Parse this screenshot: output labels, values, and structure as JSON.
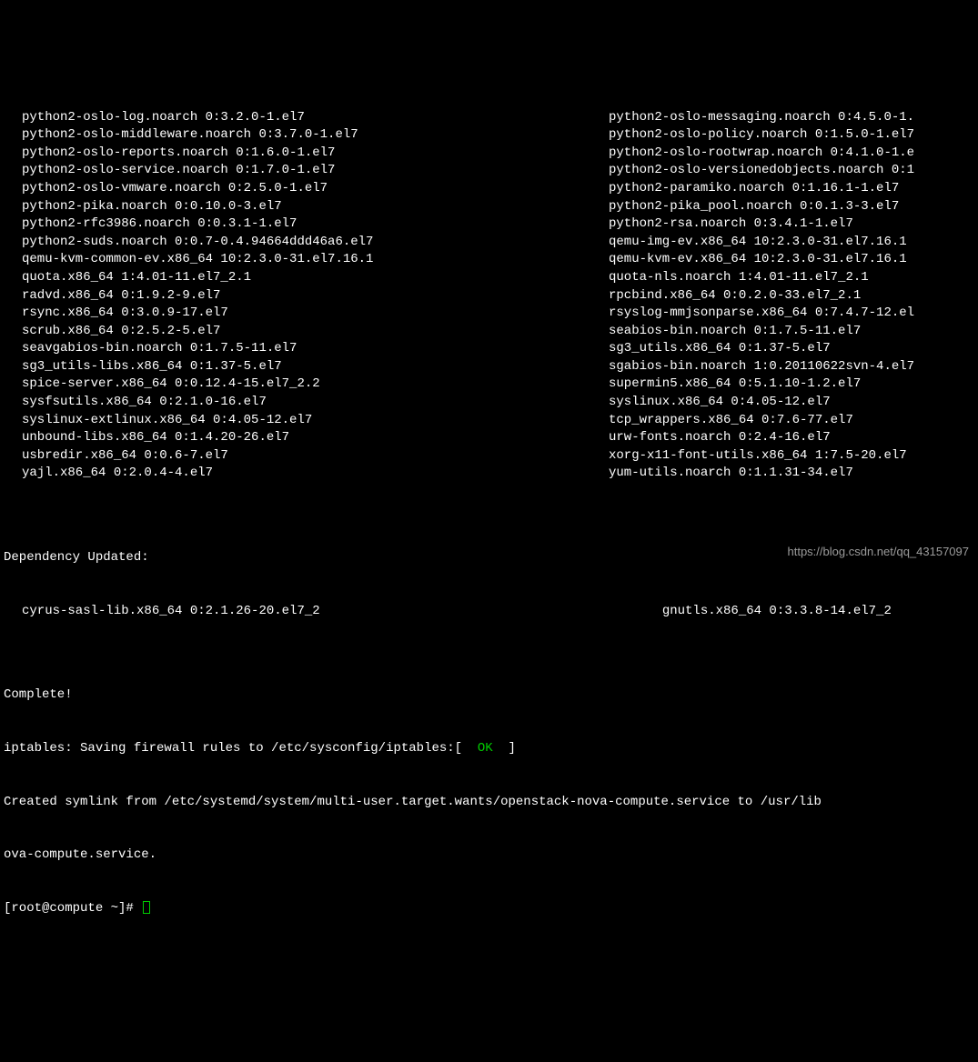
{
  "packages_left": [
    "python2-oslo-log.noarch 0:3.2.0-1.el7",
    "python2-oslo-middleware.noarch 0:3.7.0-1.el7",
    "python2-oslo-reports.noarch 0:1.6.0-1.el7",
    "python2-oslo-service.noarch 0:1.7.0-1.el7",
    "python2-oslo-vmware.noarch 0:2.5.0-1.el7",
    "python2-pika.noarch 0:0.10.0-3.el7",
    "python2-rfc3986.noarch 0:0.3.1-1.el7",
    "python2-suds.noarch 0:0.7-0.4.94664ddd46a6.el7",
    "qemu-kvm-common-ev.x86_64 10:2.3.0-31.el7.16.1",
    "quota.x86_64 1:4.01-11.el7_2.1",
    "radvd.x86_64 0:1.9.2-9.el7",
    "rsync.x86_64 0:3.0.9-17.el7",
    "scrub.x86_64 0:2.5.2-5.el7",
    "seavgabios-bin.noarch 0:1.7.5-11.el7",
    "sg3_utils-libs.x86_64 0:1.37-5.el7",
    "spice-server.x86_64 0:0.12.4-15.el7_2.2",
    "sysfsutils.x86_64 0:2.1.0-16.el7",
    "syslinux-extlinux.x86_64 0:4.05-12.el7",
    "unbound-libs.x86_64 0:1.4.20-26.el7",
    "usbredir.x86_64 0:0.6-7.el7",
    "yajl.x86_64 0:2.0.4-4.el7"
  ],
  "packages_right": [
    "python2-oslo-messaging.noarch 0:4.5.0-1.",
    "python2-oslo-policy.noarch 0:1.5.0-1.el7",
    "python2-oslo-rootwrap.noarch 0:4.1.0-1.e",
    "python2-oslo-versionedobjects.noarch 0:1",
    "python2-paramiko.noarch 0:1.16.1-1.el7",
    "python2-pika_pool.noarch 0:0.1.3-3.el7",
    "python2-rsa.noarch 0:3.4.1-1.el7",
    "qemu-img-ev.x86_64 10:2.3.0-31.el7.16.1",
    "qemu-kvm-ev.x86_64 10:2.3.0-31.el7.16.1",
    "quota-nls.noarch 1:4.01-11.el7_2.1",
    "rpcbind.x86_64 0:0.2.0-33.el7_2.1",
    "rsyslog-mmjsonparse.x86_64 0:7.4.7-12.el",
    "seabios-bin.noarch 0:1.7.5-11.el7",
    "sg3_utils.x86_64 0:1.37-5.el7",
    "sgabios-bin.noarch 1:0.20110622svn-4.el7",
    "supermin5.x86_64 0:5.1.10-1.2.el7",
    "syslinux.x86_64 0:4.05-12.el7",
    "tcp_wrappers.x86_64 0:7.6-77.el7",
    "urw-fonts.noarch 0:2.4-16.el7",
    "xorg-x11-font-utils.x86_64 1:7.5-20.el7",
    "yum-utils.noarch 0:1.1.31-34.el7"
  ],
  "dep_updated_header": "Dependency Updated:",
  "dep_updated_left": "cyrus-sasl-lib.x86_64 0:2.1.26-20.el7_2",
  "dep_updated_right": "gnutls.x86_64 0:3.3.8-14.el7_2",
  "complete": "Complete!",
  "iptables_prefix": "iptables: Saving firewall rules to /etc/sysconfig/iptables:[  ",
  "iptables_ok": "OK",
  "iptables_suffix": "  ]",
  "symlink_line1": "Created symlink from /etc/systemd/system/multi-user.target.wants/openstack-nova-compute.service to /usr/lib",
  "symlink_line2": "ova-compute.service.",
  "prompt": "[root@compute ~]# ",
  "watermark": "https://blog.csdn.net/qq_43157097"
}
